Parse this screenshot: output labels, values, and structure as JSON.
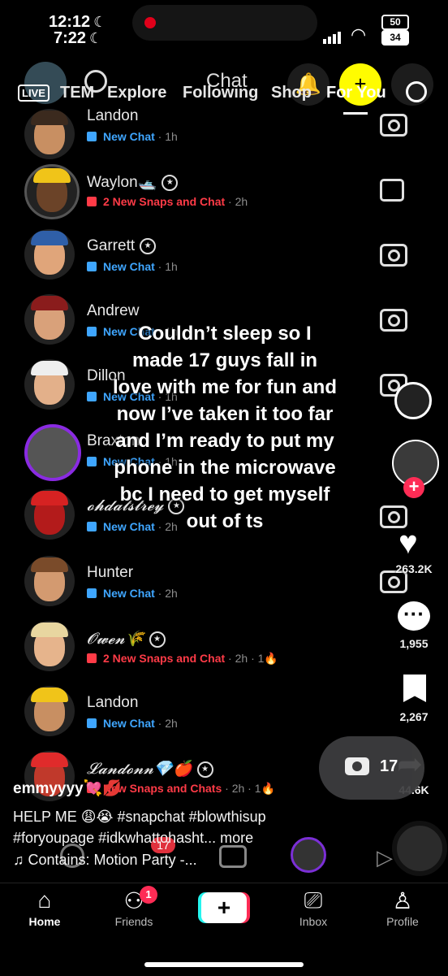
{
  "status_bar": {
    "time_primary": "12:12",
    "time_secondary": "7:22",
    "battery_primary": "50",
    "battery_secondary": "34"
  },
  "top_nav": {
    "live_label": "LIVE",
    "chat_title": "Chat",
    "tabs": [
      "TEM",
      "Explore",
      "Following",
      "Shop",
      "For You"
    ],
    "active_tab": "For You"
  },
  "chat_list": [
    {
      "name": "Landon",
      "status": "New Chat",
      "time": "1h",
      "kind": "chat",
      "badge": "",
      "streak": ""
    },
    {
      "name": "Waylon🛥️",
      "status": "2 New Snaps and Chat",
      "time": "2h",
      "kind": "snap",
      "badge": "★",
      "streak": ""
    },
    {
      "name": "Garrett",
      "status": "New Chat",
      "time": "1h",
      "kind": "chat",
      "badge": "★",
      "streak": ""
    },
    {
      "name": "Andrew",
      "status": "New Chat",
      "time": "1h",
      "kind": "chat",
      "badge": "",
      "streak": ""
    },
    {
      "name": "Dillon",
      "status": "New Chat",
      "time": "1h",
      "kind": "chat",
      "badge": "",
      "streak": ""
    },
    {
      "name": "Braxton",
      "status": "New Chat",
      "time": "1h",
      "kind": "chat",
      "badge": "",
      "streak": ""
    },
    {
      "name": "𝓸𝓱𝓭𝓪𝓽𝓼𝓽𝓻𝓮𝔂",
      "status": "New Chat",
      "time": "2h",
      "kind": "chat",
      "badge": "★",
      "streak": ""
    },
    {
      "name": "Hunter",
      "status": "New Chat",
      "time": "2h",
      "kind": "chat",
      "badge": "",
      "streak": ""
    },
    {
      "name": "𝓞𝔀𝓮𝓷🌾",
      "status": "2 New Snaps and Chat",
      "time": "2h",
      "kind": "snap",
      "badge": "★",
      "streak": "1🔥"
    },
    {
      "name": "Landon",
      "status": "New Chat",
      "time": "2h",
      "kind": "chat",
      "badge": "",
      "streak": ""
    },
    {
      "name": "𝓛𝓪𝓷𝓭𝓸𝓷𝓷💎🍎",
      "status": "New Snaps and Chats",
      "time": "2h",
      "kind": "snap",
      "badge": "★",
      "streak": "1🔥"
    }
  ],
  "overlay_caption": "Couldn’t sleep so I made 17 guys fall in love with me for fun and now I’ve taken it too far and I’m ready to put my phone in the microwave bc I need to get myself out of ts",
  "right_rail": {
    "likes": "263.2K",
    "comments": "1,955",
    "saves": "2,267",
    "shares": "44.6K"
  },
  "camera_bubble": {
    "count": "17"
  },
  "post": {
    "username": "emmyyyy💘💋",
    "description_line1": "HELP ME 😩😭 #snapchat #blowthisup",
    "description_line2": "#foryoupage #idkwhattohasht... more",
    "sound": "♫ Contains: Motion Party -..."
  },
  "snap_bottom_bar": {
    "badge_count": "17"
  },
  "tab_bar": [
    {
      "label": "Home",
      "icon": "home-icon",
      "active": true
    },
    {
      "label": "Friends",
      "icon": "friends-icon",
      "active": false,
      "badge": "1"
    },
    {
      "label": "",
      "icon": "create-plus-icon",
      "active": false
    },
    {
      "label": "Inbox",
      "icon": "inbox-icon",
      "active": false
    },
    {
      "label": "Profile",
      "icon": "profile-icon",
      "active": false
    }
  ]
}
